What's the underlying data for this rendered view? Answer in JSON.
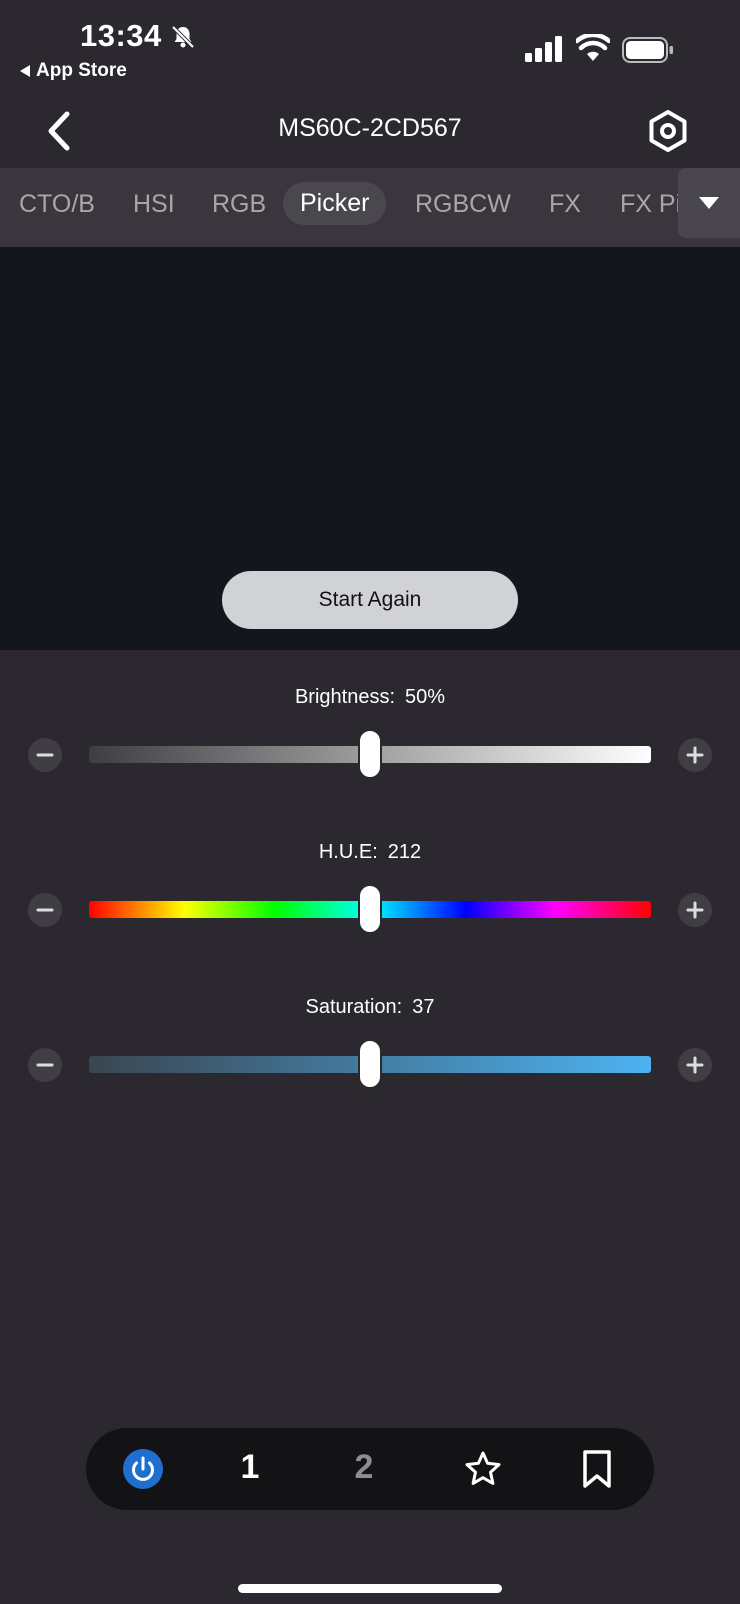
{
  "status_bar": {
    "time": "13:34",
    "back_app": "App Store"
  },
  "header": {
    "title": "MS60C-2CD567"
  },
  "tabs": [
    {
      "label": "CTO/B"
    },
    {
      "label": "HSI"
    },
    {
      "label": "RGB"
    },
    {
      "label": "Picker",
      "active": true
    },
    {
      "label": "RGBCW"
    },
    {
      "label": "FX"
    },
    {
      "label": "FX Pi"
    }
  ],
  "picker": {
    "start_again_label": "Start Again"
  },
  "sliders": {
    "brightness": {
      "label": "Brightness:",
      "value": "50%",
      "level": 0.5
    },
    "hue": {
      "label": "H.U.E:",
      "value": "212",
      "level": 0.5
    },
    "saturation": {
      "label": "Saturation:",
      "value": "37",
      "level": 0.5
    }
  },
  "bottom_bar": {
    "preset_1": "1",
    "preset_2": "2"
  },
  "icons": {
    "power": "power-icon",
    "star": "star-icon",
    "bookmark": "bookmark-icon",
    "settings": "hexagon-gear-icon"
  },
  "colors": {
    "accent": "#1f6fd1",
    "saturation_end": "#4db3f2"
  }
}
